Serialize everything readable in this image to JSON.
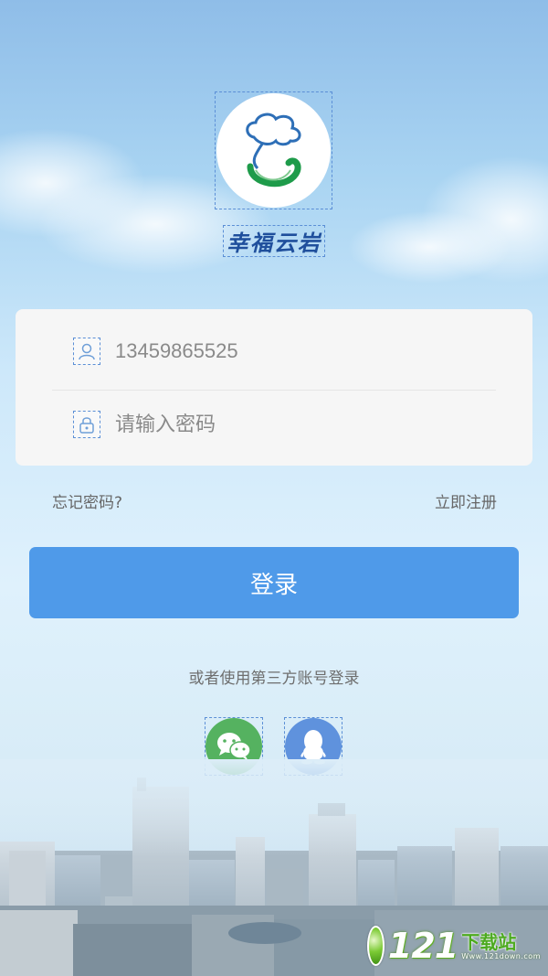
{
  "app": {
    "brand_name": "幸福云岩"
  },
  "login_form": {
    "username_value": "13459865525",
    "password_placeholder": "请输入密码"
  },
  "links": {
    "forgot_password": "忘记密码?",
    "register": "立即注册"
  },
  "login_button": {
    "label": "登录"
  },
  "third_party": {
    "prompt": "或者使用第三方账号登录",
    "options": [
      {
        "name": "wechat",
        "icon": "wechat-icon"
      },
      {
        "name": "qq",
        "icon": "qq-icon"
      }
    ]
  },
  "watermark": {
    "number": "121",
    "cn_text": "下载站",
    "en_text": "Www.121down.com"
  },
  "colors": {
    "primary": "#4f9ae9",
    "wechat": "#55b260",
    "qq": "#5f92dd",
    "brand_text": "#1f4f9c"
  }
}
